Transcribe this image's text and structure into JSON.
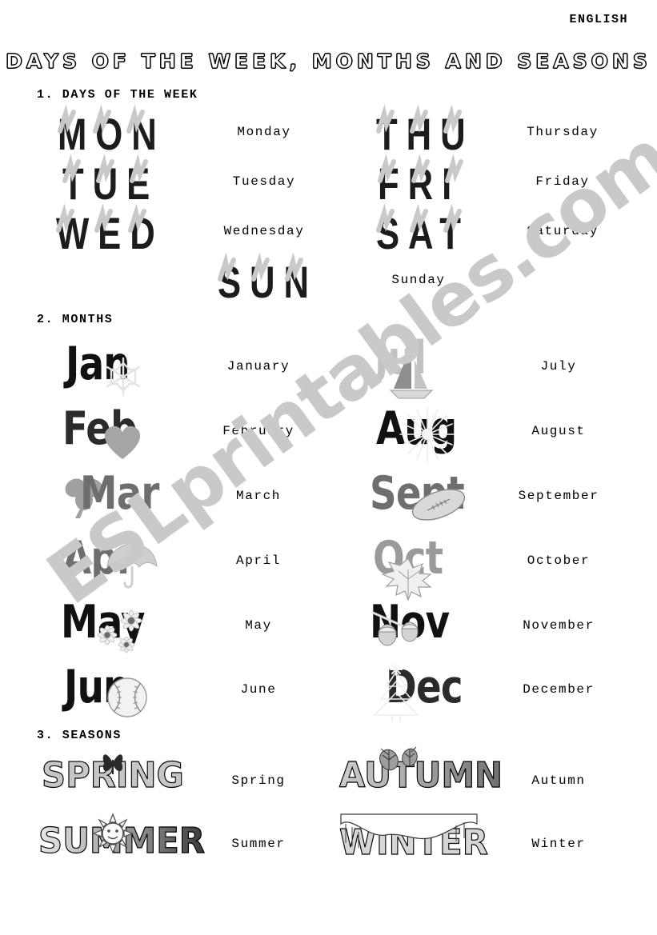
{
  "header": {
    "subject": "ENGLISH",
    "title": "DAYS OF THE WEEK, MONTHS AND SEASONS"
  },
  "watermark": {
    "text": "ESLprintables.com",
    "color": "#c9c9c9"
  },
  "sections": [
    {
      "number": "1.",
      "heading": "1. DAYS OF THE WEEK"
    },
    {
      "number": "2.",
      "heading": "2. MONTHS"
    },
    {
      "number": "3.",
      "heading": "3. SEASONS"
    }
  ],
  "days": {
    "left": [
      {
        "abbr": "MON",
        "name": "Monday",
        "icon": "scribble-icon"
      },
      {
        "abbr": "TUE",
        "name": "Tuesday",
        "icon": "scribble-icon"
      },
      {
        "abbr": "WED",
        "name": "Wednesday",
        "icon": "scribble-icon"
      }
    ],
    "right": [
      {
        "abbr": "THU",
        "name": "Thursday",
        "icon": "scribble-icon"
      },
      {
        "abbr": "FRI",
        "name": "Friday",
        "icon": "scribble-icon"
      },
      {
        "abbr": "SAT",
        "name": "Saturday",
        "icon": "scribble-icon"
      }
    ],
    "center": [
      {
        "abbr": "SUN",
        "name": "Sunday",
        "icon": "scribble-icon"
      }
    ]
  },
  "months": {
    "left": [
      {
        "abbr": "Jan",
        "name": "January",
        "icon": "snowflake-icon"
      },
      {
        "abbr": "Feb",
        "name": "February",
        "icon": "heart-icon"
      },
      {
        "abbr": "Mar",
        "name": "March",
        "icon": "shamrock-icon"
      },
      {
        "abbr": "Apr",
        "name": "April",
        "icon": "umbrella-icon"
      },
      {
        "abbr": "May",
        "name": "May",
        "icon": "flowers-icon"
      },
      {
        "abbr": "Jun",
        "name": "June",
        "icon": "baseball-icon"
      }
    ],
    "right": [
      {
        "abbr": "Jul",
        "name": "July",
        "icon": "sailboat-icon"
      },
      {
        "abbr": "Aug",
        "name": "August",
        "icon": "fireworks-icon"
      },
      {
        "abbr": "Sept",
        "name": "September",
        "icon": "football-icon"
      },
      {
        "abbr": "Oct",
        "name": "October",
        "icon": "maple-leaf-icon"
      },
      {
        "abbr": "Nov",
        "name": "November",
        "icon": "acorns-icon"
      },
      {
        "abbr": "Dec",
        "name": "December",
        "icon": "christmas-tree-icon"
      }
    ]
  },
  "seasons": {
    "left": [
      {
        "word": "SPRING",
        "name": "Spring",
        "icon": "butterfly-icon"
      },
      {
        "word": "SUMMER",
        "name": "Summer",
        "icon": "sun-face-icon"
      }
    ],
    "right": [
      {
        "word": "AUTUMN",
        "name": "Autumn",
        "icon": "falling-leaves-icon"
      },
      {
        "word": "WINTER",
        "name": "Winter",
        "icon": "snow-cap-icon"
      }
    ]
  }
}
